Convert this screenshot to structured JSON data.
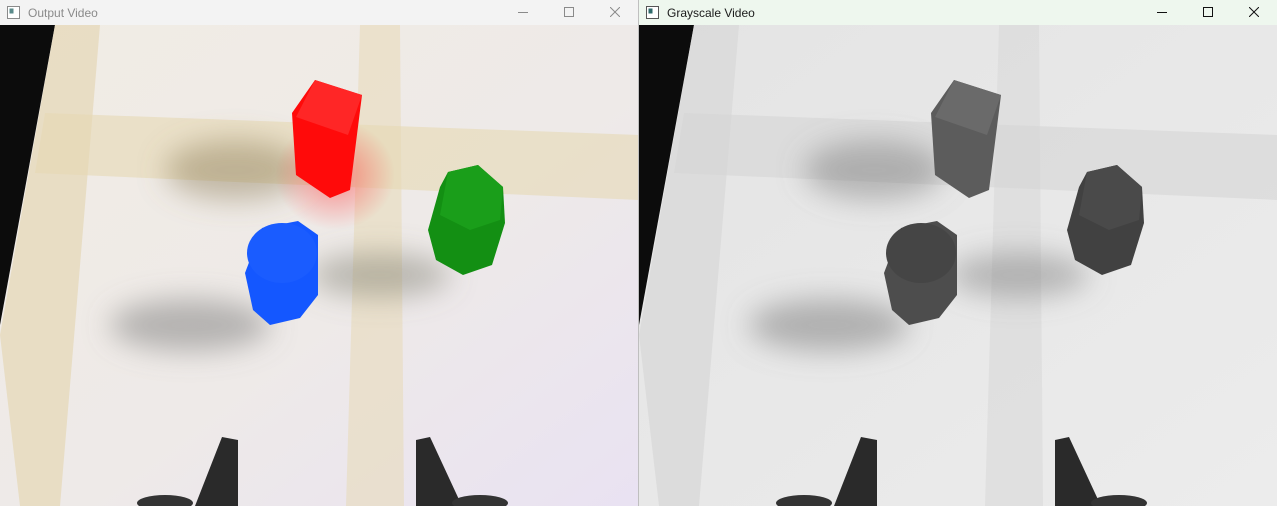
{
  "windows": [
    {
      "title": "Output Video",
      "active": false
    },
    {
      "title": "Grayscale Video",
      "active": true
    }
  ],
  "colors": {
    "red_block": "#ff0a0a",
    "green_block": "#138f13",
    "blue_block": "#1457ff",
    "title_inactive": "#8a8a8a",
    "title_active": "#1b1b1b"
  },
  "icons": {
    "window": "app-window-icon",
    "minimize": "minimize-icon",
    "maximize": "maximize-icon",
    "close": "close-icon"
  }
}
